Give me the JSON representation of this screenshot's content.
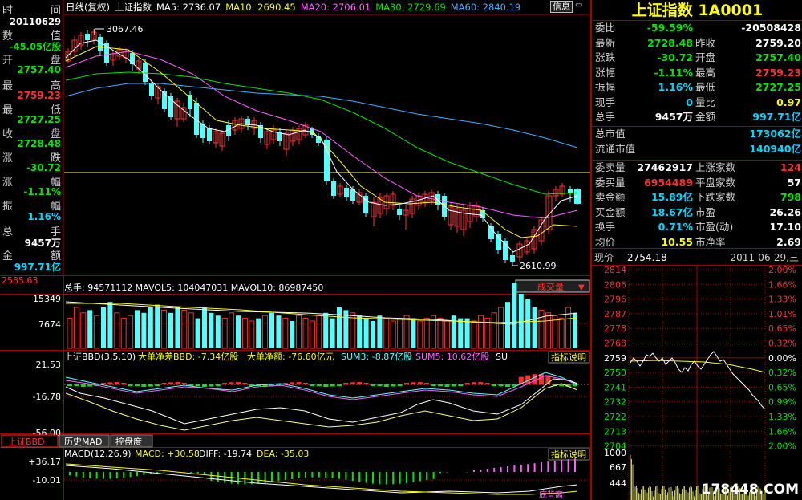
{
  "left_panel": {
    "labels": [
      "时",
      "间",
      "数",
      "值",
      "开",
      "盘",
      "最",
      "高",
      "最",
      "低",
      "收",
      "盘",
      "涨",
      "跌",
      "涨",
      "幅",
      "振",
      "幅",
      "总",
      "手",
      "金",
      "额"
    ],
    "date": "20110629",
    "change_amount": "-45.05亿股",
    "open": "2757.40",
    "high": "2759.23",
    "low": "2727.25",
    "close": "2728.48",
    "change": "-30.72",
    "change_pct": "-1.11%",
    "amplitude": "1.16%",
    "volume": "9457万",
    "amount": "997.71亿"
  },
  "header": {
    "period": "日线(复权)",
    "index_name": "上证指数",
    "ma5": "MA5: 2736.07",
    "ma10": "MA10: 2690.45",
    "ma20": "MA20: 2706.01",
    "ma30": "MA30: 2729.69",
    "ma60": "MA60: 2840.19",
    "info_button": "信息"
  },
  "main_chart": {
    "high_label": "3067.46",
    "low_label": "2610.99"
  },
  "volume_panel": {
    "axis_top": "2585.63",
    "ticks": [
      "15349",
      "7674"
    ],
    "caption": "总手: 94571112  MAVOL5: 104047031  MAVOL10: 86987450",
    "dropdown": "成交量"
  },
  "bbd_panel": {
    "caption_name": "上证BBD(3,5,10)",
    "caption_diff": "大单净差BBD: -7.34亿股",
    "caption_net": "大单净额: -76.60亿元",
    "caption_sum3": "SUM3: -8.87亿股",
    "caption_sum5": "SUM5: 10.62亿股",
    "caption_su": "SU",
    "help": "指标说明",
    "ticks": [
      "21.53",
      "-16.78",
      "-56.00"
    ]
  },
  "tabs": [
    "上证BBD",
    "历史MAD",
    "控盘度"
  ],
  "macd_panel": {
    "caption_name": "MACD(12,26,9)",
    "caption_macd": "MACD: +30.58",
    "caption_diff": "DIFF: -19.74",
    "caption_dea": "DEA: -35.03",
    "help": "指标说明",
    "ticks": [
      "+36.17",
      "-10.01"
    ],
    "note": "底背离"
  },
  "right_panel": {
    "title": "上证指数 1A0001",
    "rows": [
      {
        "l1": "委比",
        "v1": "-59.59%",
        "c1": "g",
        "l2": "",
        "v2": "-20508428",
        "c2": "w"
      },
      {
        "l1": "最新",
        "v1": "2728.48",
        "c1": "g",
        "l2": "昨收",
        "v2": "2759.20",
        "c2": "w"
      },
      {
        "l1": "涨跌",
        "v1": "-30.72",
        "c1": "g",
        "l2": "开盘",
        "v2": "2757.40",
        "c2": "g"
      },
      {
        "l1": "涨幅",
        "v1": "-1.11%",
        "c1": "g",
        "l2": "最高",
        "v2": "2759.23",
        "c2": "r"
      },
      {
        "l1": "振幅",
        "v1": "1.16%",
        "c1": "c",
        "l2": "最低",
        "v2": "2727.25",
        "c2": "g"
      },
      {
        "l1": "现手",
        "v1": "0",
        "c1": "c",
        "l2": "量比",
        "v2": "0.97",
        "c2": "y"
      },
      {
        "l1": "总手",
        "v1": "9457万",
        "c1": "w",
        "l2": "金额",
        "v2": "997.71亿",
        "c2": "c"
      },
      {
        "l1": "总市值",
        "v1": "",
        "c1": "w",
        "l2": "",
        "v2": "173062亿",
        "c2": "c"
      },
      {
        "l1": "流通市值",
        "v1": "",
        "c1": "w",
        "l2": "",
        "v2": "140940亿",
        "c2": "c"
      },
      {
        "l1": "委卖量",
        "v1": "27462917",
        "c1": "w",
        "l2": "上涨家数",
        "v2": "124",
        "c2": "r"
      },
      {
        "l1": "委买量",
        "v1": "6954489",
        "c1": "r",
        "l2": "平盘家数",
        "v2": "57",
        "c2": "w"
      },
      {
        "l1": "卖金额",
        "v1": "15.89亿",
        "c1": "c",
        "l2": "下跌家数",
        "v2": "798",
        "c2": "g"
      },
      {
        "l1": "买金额",
        "v1": "18.67亿",
        "c1": "c",
        "l2": "市盈",
        "v2": "26.26",
        "c2": "w"
      },
      {
        "l1": "换手",
        "v1": "0.71%",
        "c1": "c",
        "l2": "市盈(动)",
        "v2": "17.10",
        "c2": "w"
      },
      {
        "l1": "均价",
        "v1": "10.55",
        "c1": "y",
        "l2": "市净率",
        "v2": "2.69",
        "c2": "w"
      }
    ],
    "intraday": {
      "price_label": "现价",
      "price": "2754.18",
      "date": "2011-06-29,三",
      "left_ticks": [
        "2814",
        "2806",
        "2796",
        "2787",
        "2778",
        "2768",
        "2759",
        "2750",
        "2741",
        "2732",
        "2722",
        "2713",
        "2704"
      ],
      "right_ticks": [
        "2.00%",
        "1.66%",
        "1.33%",
        "1.01%",
        "0.65%",
        "0.32%",
        "0.00%",
        "0.32%",
        "0.65%",
        "0.99%",
        "1.33%",
        "1.66%",
        "2.00%"
      ],
      "vol_ticks": [
        "1000",
        "667",
        "444"
      ],
      "watermark": "178448.COM"
    }
  },
  "colors": {
    "up": "#ff3030",
    "down": "#00e600",
    "cyan": "#54ffff",
    "grid": "#a00000"
  }
}
